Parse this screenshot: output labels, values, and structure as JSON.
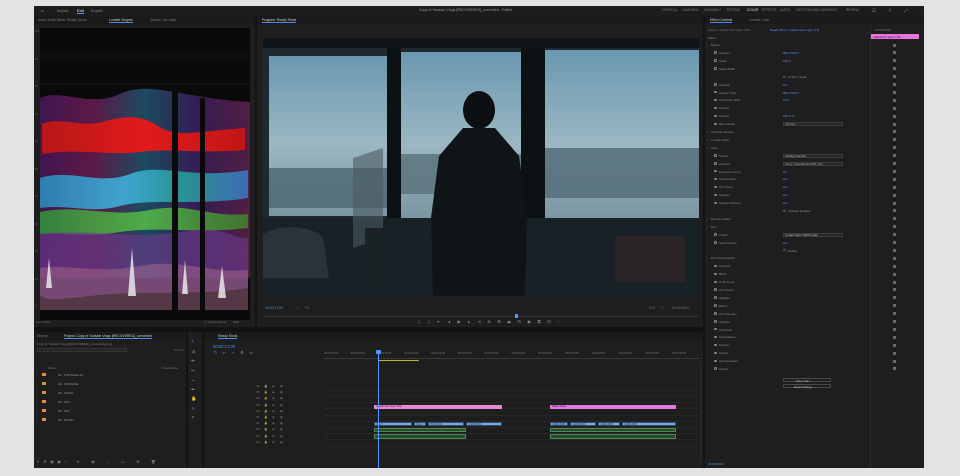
{
  "menubar": {
    "home_icon": "home-icon",
    "tabs": [
      "Import",
      "Edit",
      "Export"
    ],
    "active_tab": "Edit",
    "title": "Copy of Youtube Vlogs [RECOVERED]_converted - Edited",
    "workspaces": [
      "VERTICAL",
      "LEARNING",
      "ASSEMBLY",
      "EDITING",
      "COLOR",
      "EFFECTS",
      "AUDIO",
      "CAPTIONS AND GRAPHICS",
      "REVIEW"
    ],
    "active_workspace": "COLOR"
  },
  "scopes_panel": {
    "tabs": [
      "Audio Track Mixer: Ready Shots",
      "Lumetri Scopes",
      "Source: (no clips)"
    ],
    "active_tab": "Lumetri Scopes",
    "footer_left": "Clamp Signal",
    "footer_bits": "8 Bit",
    "footer_value": "Lum: 00%",
    "y_labels": [
      "100",
      "90",
      "80",
      "70",
      "60",
      "50",
      "40",
      "30",
      "20",
      "10",
      "0"
    ]
  },
  "program_monitor": {
    "title": "Program: Ready Shots",
    "timecode_left": "00:02:17:00",
    "fit": "Fit",
    "full": "Full",
    "timecode_right": "00:00:08:21"
  },
  "effect_controls": {
    "tabs": [
      "Effect Controls",
      "Lumetri Color"
    ],
    "active_tab": "Effect Controls",
    "source": "Source • Adjustment Layer (76)",
    "target": "Ready Shots • Adjustment Layer (76)",
    "timecode": "00:00:28:00",
    "clip_label": "Adjustment Layer (76)",
    "section": "Video",
    "rows": [
      {
        "label": "Motion",
        "value": ""
      },
      {
        "label": "Position",
        "value": "960.0   540.0"
      },
      {
        "label": "Scale",
        "value": "100.0"
      },
      {
        "label": "Scale Width",
        "value": ""
      },
      {
        "label": "",
        "value": "Uniform Scale"
      },
      {
        "label": "Rotation",
        "value": "0.0"
      },
      {
        "label": "Anchor Point",
        "value": "960.0   540.0"
      },
      {
        "label": "Anti-flicker Filter",
        "value": "0.00"
      },
      {
        "label": "Opacity",
        "value": ""
      },
      {
        "label": "Opacity",
        "value": "100.0 %"
      },
      {
        "label": "Blend Mode",
        "value": "Normal"
      },
      {
        "label": "Time Remapping",
        "value": ""
      },
      {
        "label": "Lumetri Color",
        "value": ""
      },
      {
        "label": "Input",
        "value": ""
      },
      {
        "label": "Source",
        "value": "Change Camera"
      },
      {
        "label": "Camera",
        "value": "Sony / Cinema Line FX6 / S-L..."
      },
      {
        "label": "Exposure Comp",
        "value": "0.0"
      },
      {
        "label": "Temperature",
        "value": "0.0"
      },
      {
        "label": "Tint Comp",
        "value": "0.0"
      },
      {
        "label": "Settings",
        "value": "0.0"
      },
      {
        "label": "Settings Buttons",
        "value": "0.0"
      },
      {
        "label": "",
        "value": "Settings Enabled"
      },
      {
        "label": "Film Emulation",
        "value": ""
      },
      {
        "label": "Film",
        "value": ""
      },
      {
        "label": "Profile",
        "value": "Kodak Vision 2383 Kodak"
      },
      {
        "label": "Scan Profiles",
        "value": "0.0"
      },
      {
        "label": "",
        "value": "Enable"
      },
      {
        "label": "Film Compression",
        "value": ""
      },
      {
        "label": "Contrast",
        "value": ""
      },
      {
        "label": "Black",
        "value": ""
      },
      {
        "label": "Color Level",
        "value": ""
      },
      {
        "label": "Film Curve",
        "value": ""
      },
      {
        "label": "Halation",
        "value": ""
      },
      {
        "label": "Bloom",
        "value": ""
      },
      {
        "label": "Film Damage",
        "value": ""
      },
      {
        "label": "Vignette",
        "value": ""
      },
      {
        "label": "Timecode",
        "value": ""
      },
      {
        "label": "Gate Weave",
        "value": ""
      },
      {
        "label": "Monitor",
        "value": ""
      },
      {
        "label": "Output",
        "value": ""
      },
      {
        "label": "Gift Generator",
        "value": ""
      },
      {
        "label": "Device",
        "value": ""
      }
    ],
    "buttons": [
      "Setup Clip",
      "Reset Settings"
    ]
  },
  "project_panel": {
    "tabs": [
      "History",
      "Project: Copy of Youtube Vlogs [RECOVERED]_converted"
    ],
    "active_tab": "Project: Copy of Youtube Vlogs [RECOVERED]_converted",
    "path": "Copy of Youtube Vlogs [RECOVERED]_converted.prproj",
    "count": "6 items",
    "col_name": "Name",
    "col_rate": "Frame Rate",
    "items": [
      "01 - FOOTAGE 4K",
      "02 - FOOTAGE",
      "03 - AUDIO",
      "04 - GFX",
      "05 - SFX",
      "06 - MUSIC"
    ]
  },
  "timeline": {
    "title": "Ready Shots",
    "timecode": "00:02:17:00",
    "ruler": [
      "00:02:06:00",
      "00:02:08:00",
      "00:02:10:00",
      "00:02:12:00",
      "00:02:14:00",
      "00:02:16:00",
      "00:02:18:00",
      "00:02:20:00",
      "00:02:22:00",
      "00:02:24:00",
      "00:02:26:00",
      "00:02:28:00",
      "00:02:30:00",
      "00:02:32:00"
    ],
    "clips": [
      {
        "label": "Adjustment Layer (76)",
        "color": "#e68ad8"
      },
      {
        "label": "Adjust Layer",
        "color": "#e07ce0"
      }
    ],
    "video_clips": [
      "Clip 3",
      "Clip 4",
      "P1031 Clip",
      "C0211.MP4",
      "C0221.MP4",
      "C0231.MP4",
      "C0241.MP4",
      "C0251.MP4"
    ]
  },
  "colors": {
    "accent_blue": "#4f96ff",
    "clip_pink": "#e68ad8",
    "folder_orange": "#e1942d",
    "clip_video": "#7fa7d8"
  }
}
